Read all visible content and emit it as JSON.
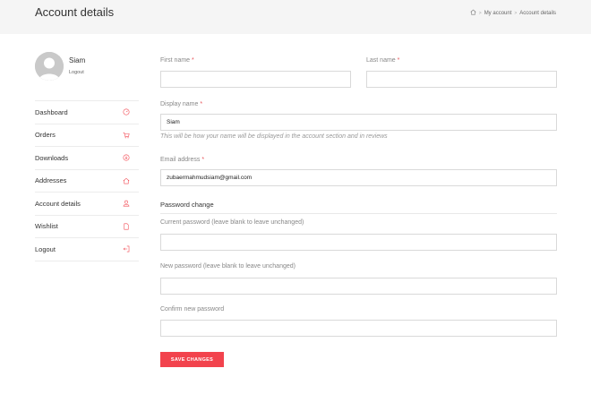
{
  "header": {
    "title": "Account details",
    "breadcrumb": [
      "My account",
      "Account details"
    ]
  },
  "user": {
    "name": "Siam",
    "logout": "Logout"
  },
  "nav": {
    "items": [
      {
        "label": "Dashboard",
        "icon": "dashboard-gauge-icon"
      },
      {
        "label": "Orders",
        "icon": "cart-icon"
      },
      {
        "label": "Downloads",
        "icon": "download-icon"
      },
      {
        "label": "Addresses",
        "icon": "home-icon"
      },
      {
        "label": "Account details",
        "icon": "user-icon"
      },
      {
        "label": "Wishlist",
        "icon": "document-icon"
      },
      {
        "label": "Logout",
        "icon": "logout-icon"
      }
    ]
  },
  "form": {
    "first_name_label": "First name",
    "last_name_label": "Last name",
    "first_name_value": "",
    "last_name_value": "",
    "display_name_label": "Display name",
    "display_name_value": "Siam",
    "display_name_hint": "This will be how your name will be displayed in the account section and in reviews",
    "email_label": "Email address",
    "email_value": "zubaermahmudsiam@gmail.com",
    "password_section": "Password change",
    "current_password_label": "Current password (leave blank to leave unchanged)",
    "new_password_label": "New password (leave blank to leave unchanged)",
    "confirm_password_label": "Confirm new password",
    "required_mark": "*",
    "save_label": "SAVE CHANGES"
  },
  "colors": {
    "accent": "#f2434d",
    "header_bg": "#f5f5f5"
  }
}
